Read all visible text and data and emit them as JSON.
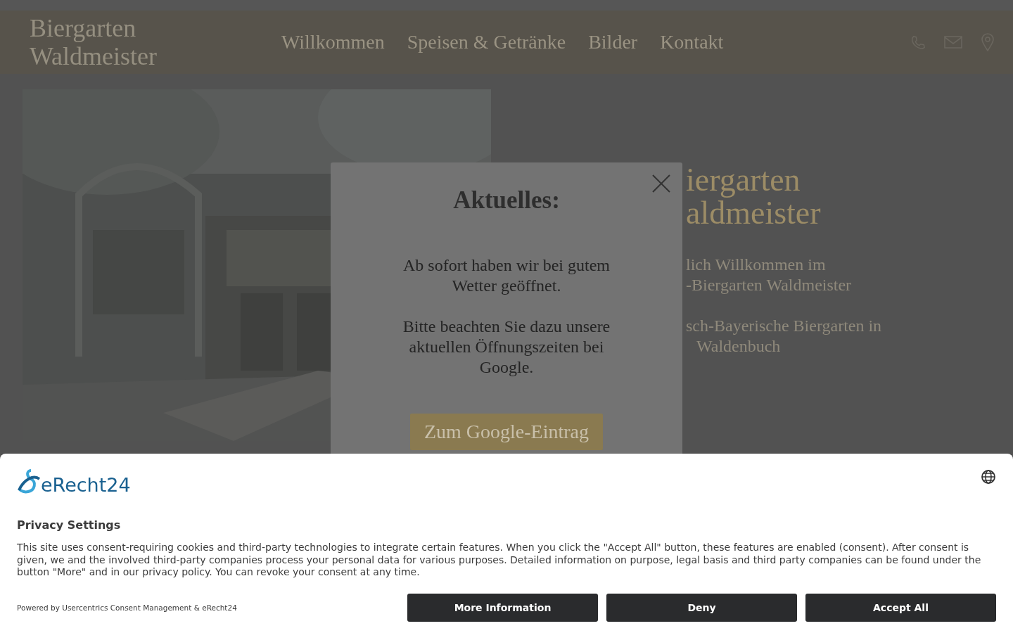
{
  "header": {
    "logo_lines": [
      "Biergarten",
      "Waldmeister"
    ],
    "nav": [
      "Willkommen",
      "Speisen & Getränke",
      "Bilder",
      "Kontakt"
    ]
  },
  "hero": {
    "title_lines": [
      "iergarten",
      "aldmeister"
    ],
    "paragraphs": [
      [
        "lich Willkommen im",
        "-Biergarten Waldmeister"
      ],
      [
        "sch-Bayerische Biergarten in",
        "Waldenbuch"
      ]
    ]
  },
  "modal": {
    "title": "Aktuelles:",
    "paragraphs": [
      "Ab sofort haben wir bei gutem Wetter geöffnet.",
      "Bitte beachten Sie dazu unsere aktuellen Öffnungszeiten bei Google."
    ],
    "button": "Zum Google-Eintrag"
  },
  "consent": {
    "brand": "eRecht24",
    "title": "Privacy Settings",
    "text": "This site uses consent-requiring cookies and third-party technologies to integrate certain features. When you click the \"Accept All\" button, these features are enabled (consent). After consent is given, we and the involved third-party companies process your personal data for various purposes. Detailed information on purpose, legal basis and third party companies can be found under the button \"More\" and in our privacy policy. You can revoke your consent at any time.",
    "powered_by": "Powered by Usercentrics Consent Management & eRecht24",
    "buttons": [
      "More Information",
      "Deny",
      "Accept All"
    ]
  }
}
